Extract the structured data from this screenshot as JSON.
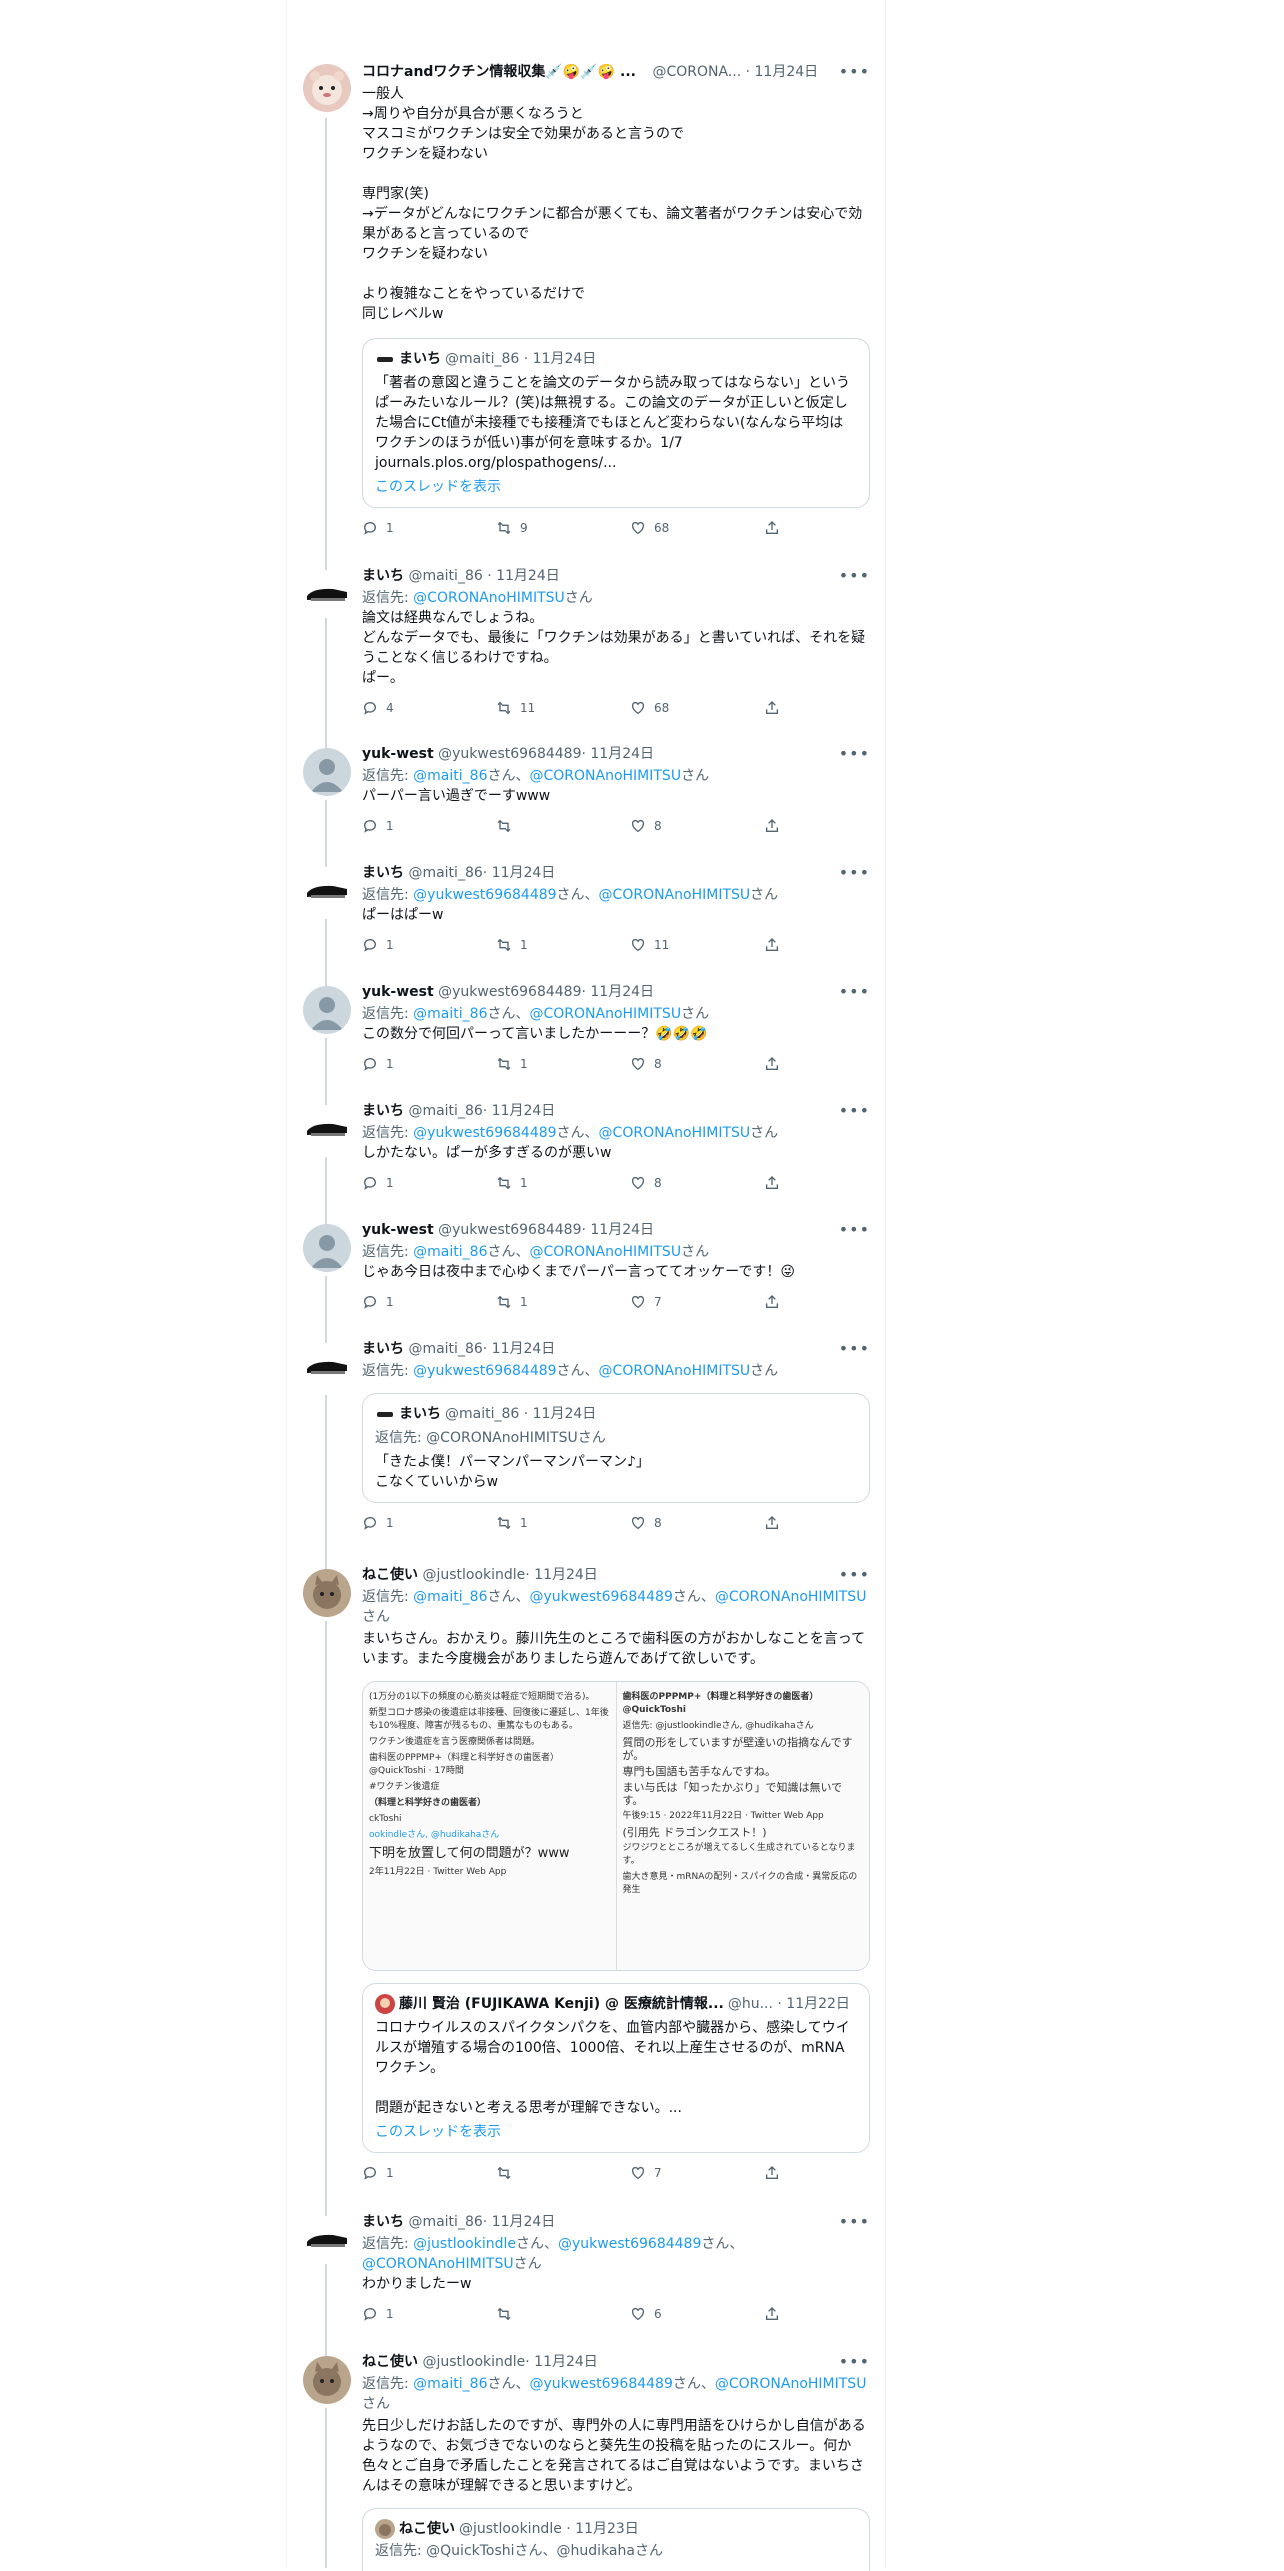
{
  "colors": {
    "link": "#1d9bf0",
    "meta": "#536471",
    "border": "#cfd9de",
    "text": "#0f1419"
  },
  "icons": {
    "more": "more-icon",
    "reply": "reply-icon",
    "retweet": "retweet-icon",
    "like": "like-icon",
    "share": "share-icon"
  },
  "tweets": [
    {
      "name": "コロナandワクチン情報収集💉🤪💉🤪 ...",
      "handle": "@CORONA...",
      "date": "· 11月24日",
      "text": "一般人\n→周りや自分が具合が悪くなろうと\nマスコミがワクチンは安全で効果があると言うので\nワクチンを疑わない\n\n専門家(笑)\n→データがどんなにワクチンに都合が悪くても、論文著者がワクチンは安心で効果があると言っているので\nワクチンを疑わない\n\nより複雑なことをやっているだけで\n同じレベルw",
      "quote": {
        "name": "まいち",
        "handle": "@maiti_86 · 11月24日",
        "text": "「著者の意図と違うことを論文のデータから読み取ってはならない」というぱーみたいなルール？(笑)は無視する。この論文のデータが正しいと仮定した場合にCt値が未接種でも接種済でもほとんど変わらない(なんなら平均はワクチンのほうが低い)事が何を意味するか。1/7\njournals.plos.org/plospathogens/...",
        "show_thread": "このスレッドを表示"
      },
      "replies": "1",
      "retweets": "9",
      "likes": "68"
    },
    {
      "name": "まいち",
      "handle": "@maiti_86",
      "date": "· 11月24日",
      "reply_prefix": "返信先: ",
      "reply_to": "@CORONAnoHIMITSU",
      "reply_suffix": "さん",
      "text": "論文は経典なんでしょうね。\nどんなデータでも、最後に「ワクチンは効果がある」と書いていれば、それを疑うことなく信じるわけですね。\nぱー。",
      "replies": "4",
      "retweets": "11",
      "likes": "68"
    },
    {
      "name": "yuk-west",
      "handle": "@yukwest69684489",
      "date": "· 11月24日",
      "reply_prefix": "返信先: ",
      "reply_to": "@maiti_86",
      "reply_mid": "さん、",
      "reply_to2": "@CORONAnoHIMITSU",
      "reply_suffix": "さん",
      "text": "パーパー言い過ぎでーすwww",
      "replies": "1",
      "retweets": "",
      "likes": "8"
    },
    {
      "name": "まいち",
      "handle": "@maiti_86",
      "date": "· 11月24日",
      "reply_prefix": "返信先: ",
      "reply_to": "@yukwest69684489",
      "reply_mid": "さん、",
      "reply_to2": "@CORONAnoHIMITSU",
      "reply_suffix": "さん",
      "text": "ぱーはぱーw",
      "replies": "1",
      "retweets": "1",
      "likes": "11"
    },
    {
      "name": "yuk-west",
      "handle": "@yukwest69684489",
      "date": "· 11月24日",
      "reply_prefix": "返信先: ",
      "reply_to": "@maiti_86",
      "reply_mid": "さん、",
      "reply_to2": "@CORONAnoHIMITSU",
      "reply_suffix": "さん",
      "text": "この数分で何回パーって言いましたかーーー？🤣🤣🤣",
      "replies": "1",
      "retweets": "1",
      "likes": "8"
    },
    {
      "name": "まいち",
      "handle": "@maiti_86",
      "date": "· 11月24日",
      "reply_prefix": "返信先: ",
      "reply_to": "@yukwest69684489",
      "reply_mid": "さん、",
      "reply_to2": "@CORONAnoHIMITSU",
      "reply_suffix": "さん",
      "text": "しかたない。ぱーが多すぎるのが悪いw",
      "replies": "1",
      "retweets": "1",
      "likes": "8"
    },
    {
      "name": "yuk-west",
      "handle": "@yukwest69684489",
      "date": "· 11月24日",
      "reply_prefix": "返信先: ",
      "reply_to": "@maiti_86",
      "reply_mid": "さん、",
      "reply_to2": "@CORONAnoHIMITSU",
      "reply_suffix": "さん",
      "text": "じゃあ今日は夜中まで心ゆくまでパーパー言っててオッケーです！😜",
      "replies": "1",
      "retweets": "1",
      "likes": "7"
    },
    {
      "name": "まいち",
      "handle": "@maiti_86",
      "date": "· 11月24日",
      "reply_prefix": "返信先: ",
      "reply_to": "@yukwest69684489",
      "reply_mid": "さん、",
      "reply_to2": "@CORONAnoHIMITSU",
      "reply_suffix": "さん",
      "text": "",
      "quote": {
        "name": "まいち",
        "handle": "@maiti_86 · 11月24日",
        "reply_line": "返信先: @CORONAnoHIMITSUさん",
        "text": "「きたよ僕！パーマンパーマンパーマン♪」\nこなくていいからw"
      },
      "replies": "1",
      "retweets": "1",
      "likes": "8"
    },
    {
      "name": "ねこ使い",
      "handle": "@justlookindle",
      "date": "· 11月24日",
      "reply_prefix": "返信先: ",
      "reply_to": "@maiti_86",
      "reply_mid": "さん、",
      "reply_to2": "@yukwest69684489",
      "reply_mid2": "さん、",
      "reply_to3": "@CORONAnoHIMITSU",
      "reply_suffix": "さん",
      "text": "まいちさん。おかえり。藤川先生のところで歯科医の方がおかしなことを言っています。また今度機会がありましたら遊んであげて欲しいです。",
      "media": {
        "left": {
          "l1": "(1万分の1以下の頻度の心筋炎は軽症で短期間で治る)。",
          "l2": "新型コロナ感染の後遺症は非接種、回復後に遷延し、1年後も10%程度、障害が残るもの、重篤なものもある。",
          "l3": "ワクチン後遺症を言う医療関係者は問題。",
          "l4": "歯科医のPPPMP+（料理と科学好きの歯医者）@QuickToshi · 17時間",
          "l5": "#ワクチン後遺症",
          "l6": "（料理と科学好きの歯医者）",
          "l7": "ckToshi",
          "l8": "ookindleさん, @hudikahaさん",
          "l9": "下明を放置して何の問題が？www",
          "l10": "2年11月22日 · Twitter Web App"
        },
        "right": {
          "r1": "歯科医のPPPMP+（料理と科学好きの歯医者）@QuickToshi",
          "r2": "返信先: @justlookindleさん, @hudikahaさん",
          "r3": "質問の形をしていますが壁達いの指摘なんですが。",
          "r4": "専門も国語も苦手なんですね。",
          "r5": "まい与氏は「知ったかぶり」で知識は無いです。",
          "r6": "午後9:15 · 2022年11月22日 · Twitter Web App",
          "r7": "(引用先 ドラゴンクエスト！)",
          "r8": "ジワジワとところが増えてるしく生成されているとなります。",
          "r9": "歯大き意見・mRNAの配列・スパイクの合成・異常反応の発生"
        }
      },
      "quote": {
        "name": "藤川 賢治 (FUJIKAWA Kenji) @ 医療統計情報...",
        "handle": "@hu... · 11月22日",
        "text": "コロナウイルスのスパイクタンパクを、血管内部や臓器から、感染してウイルスが増殖する場合の100倍、1000倍、それ以上産生させるのが、mRNAワクチン。\n\n問題が起きないと考える思考が理解できない。...",
        "show_thread": "このスレッドを表示"
      },
      "replies": "1",
      "retweets": "",
      "likes": "7"
    },
    {
      "name": "まいち",
      "handle": "@maiti_86",
      "date": "· 11月24日",
      "reply_prefix": "返信先: ",
      "reply_to": "@justlookindle",
      "reply_mid": "さん、",
      "reply_to2": "@yukwest69684489",
      "reply_mid2": "さん、",
      "reply_to3": "@CORONAnoHIMITSU",
      "reply_suffix": "さん",
      "text": "わかりましたーw",
      "replies": "1",
      "retweets": "",
      "likes": "6"
    },
    {
      "name": "ねこ使い",
      "handle": "@justlookindle",
      "date": "· 11月24日",
      "reply_prefix": "返信先: ",
      "reply_to": "@maiti_86",
      "reply_mid": "さん、",
      "reply_to2": "@yukwest69684489",
      "reply_mid2": "さん、",
      "reply_to3": "@CORONAnoHIMITSU",
      "reply_suffix": "さん",
      "text": "先日少しだけお話したのですが、専門外の人に専門用語をひけらかし自信があるようなので、お気づきでないのならと葵先生の投稿を貼ったのにスルー。何か色々とご自身で矛盾したことを発言されてるはご自覚はないようです。まいちさんはその意味が理解できると思いますけど。",
      "quote": {
        "name": "ねこ使い",
        "handle": "@justlookindle · 11月23日",
        "reply_line": "返信先: @QuickToshiさん、@hudikahaさん"
      }
    }
  ]
}
